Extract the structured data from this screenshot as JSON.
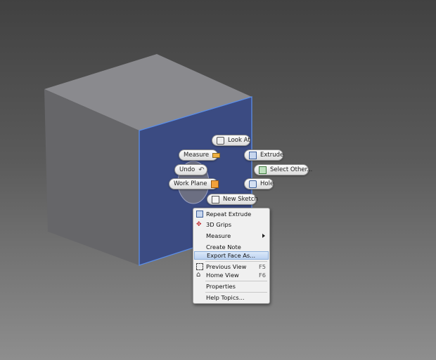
{
  "marking_menu": {
    "look_at": "Look At",
    "measure": "Measure",
    "extrude": "Extrude",
    "undo": "Undo",
    "select_other": "Select Other...",
    "work_plane": "Work Plane",
    "hole": "Hole",
    "new_sketch": "New Sketch"
  },
  "context_menu": {
    "items": [
      {
        "label": "Repeat Extrude",
        "icon": "extrude-icon"
      },
      {
        "label": "3D Grips",
        "icon": "grips-icon"
      },
      {
        "label": "Measure",
        "submenu": true
      },
      {
        "label": "Create Note"
      },
      {
        "label": "Export Face As...",
        "highlighted": true
      },
      {
        "label": "Previous View",
        "shortcut": "F5",
        "icon": "previous-view-icon"
      },
      {
        "label": "Home View",
        "shortcut": "F6",
        "icon": "home-view-icon"
      },
      {
        "label": "Properties"
      },
      {
        "label": "Help Topics..."
      }
    ]
  },
  "colors": {
    "selected_face": "#3b4b82",
    "highlight_edge": "#5b8ee8",
    "cube_top": "#8a8a8e",
    "cube_left": "#656569"
  }
}
